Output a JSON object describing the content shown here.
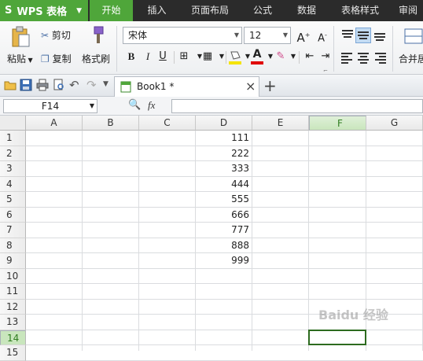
{
  "app": {
    "name": "WPS 表格",
    "logo": "S"
  },
  "menu": [
    "开始",
    "插入",
    "页面布局",
    "公式",
    "数据",
    "表格样式",
    "审阅"
  ],
  "menu_active": 0,
  "ribbon": {
    "paste": "粘贴",
    "cut": "剪切",
    "copy": "复制",
    "format_painter": "格式刷",
    "font_name": "宋体",
    "font_size": "12",
    "bold": "B",
    "italic": "I",
    "underline": "U",
    "font_color_letter": "A",
    "merge": "合并居"
  },
  "doc_tab": {
    "title": "Book1 *",
    "close": "×",
    "new": "+"
  },
  "formula_bar": {
    "name_box": "F14",
    "fx": "fx",
    "value": ""
  },
  "columns": [
    "A",
    "B",
    "C",
    "D",
    "E",
    "F",
    "G"
  ],
  "selected_column": "F",
  "rows": [
    "1",
    "2",
    "3",
    "4",
    "5",
    "6",
    "7",
    "8",
    "9",
    "10",
    "11",
    "12",
    "13",
    "14",
    "15"
  ],
  "selected_row": "14",
  "column_d_values": [
    "111",
    "222",
    "333",
    "444",
    "555",
    "666",
    "777",
    "888",
    "999"
  ],
  "watermark": "Baidu 经验",
  "colors": {
    "accent": "#4fa63a",
    "menubar": "#2b2b2b",
    "selection_border": "#2d6b1f"
  }
}
